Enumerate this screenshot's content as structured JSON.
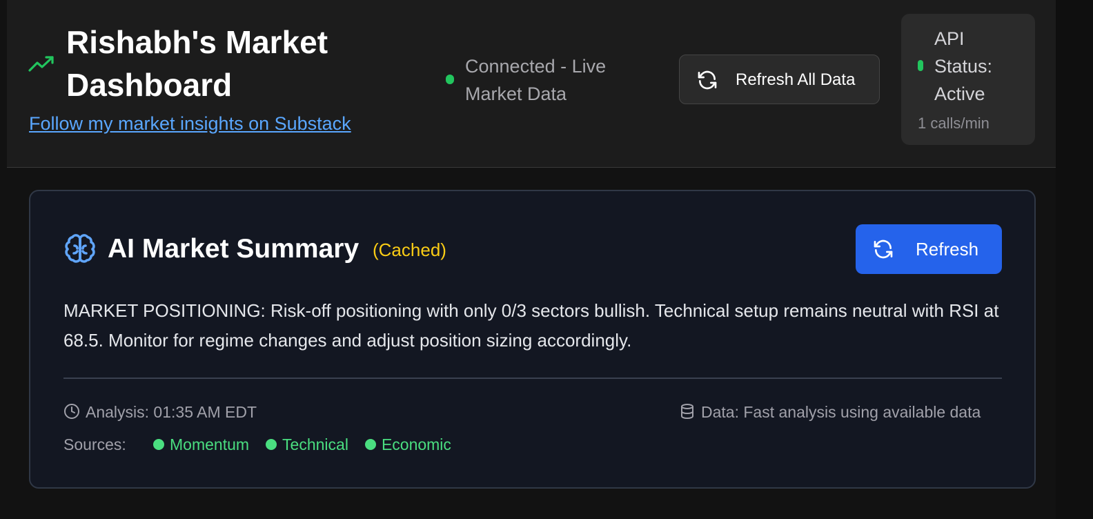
{
  "header": {
    "title": "Rishabh's Market Dashboard",
    "substack_link": "Follow my market insights on Substack",
    "connection_status": "Connected - Live Market Data",
    "refresh_all_label": "Refresh All Data",
    "api_status": "API Status: Active",
    "api_calls": "1 calls/min"
  },
  "summary_card": {
    "title": "AI Market Summary",
    "cache_badge": "(Cached)",
    "refresh_label": "Refresh",
    "text": "MARKET POSITIONING: Risk-off positioning with only 0/3 sectors bullish. Technical setup remains neutral with RSI at 68.5. Monitor for regime changes and adjust position sizing accordingly.",
    "analysis_time": "Analysis: 01:35 AM EDT",
    "data_note": "Data: Fast analysis using available data",
    "sources_label": "Sources:",
    "sources": [
      "Momentum",
      "Technical",
      "Economic"
    ]
  },
  "colors": {
    "accent_blue": "#2563eb",
    "status_green": "#22c55e",
    "cached_yellow": "#facc15",
    "link_blue": "#5aa7ff"
  },
  "icons": [
    "trending-up-icon",
    "refresh-icon",
    "brain-icon",
    "clock-icon",
    "database-icon"
  ]
}
